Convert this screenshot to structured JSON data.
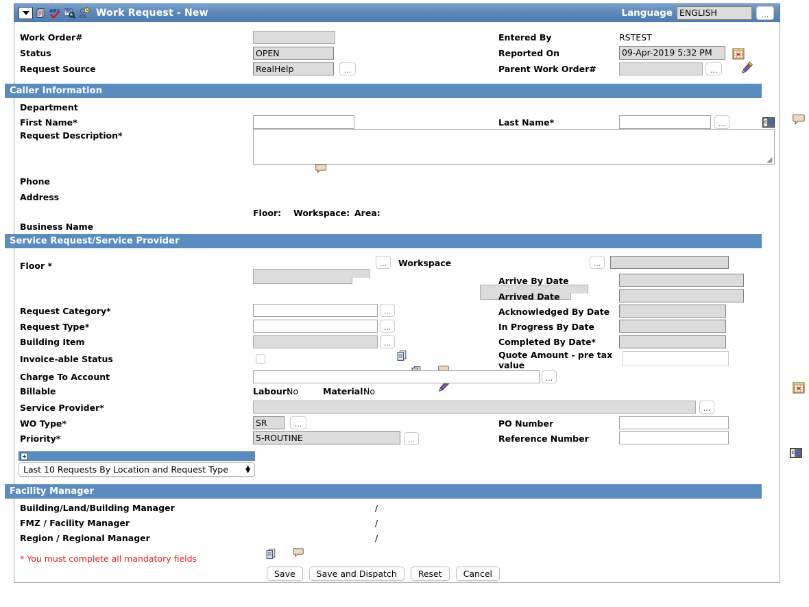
{
  "titlebar": {
    "title": "Work Request - New",
    "language_label": "Language",
    "language_value": "ENGLISH",
    "ellipsis": "...",
    "icons": [
      "dropdown-arrow-icon",
      "copy-records-icon",
      "spellcheck-abc-icon",
      "save-as-icon",
      "user-clock-icon"
    ]
  },
  "top": {
    "work_order_label": "Work Order#",
    "work_order_value": "",
    "status_label": "Status",
    "status_value": "OPEN",
    "request_source_label": "Request Source",
    "request_source_value": "RealHelp",
    "entered_by_label": "Entered By",
    "entered_by_value": "RSTEST",
    "reported_on_label": "Reported On",
    "reported_on_value": "09-Apr-2019 5:32 PM",
    "parent_work_order_label": "Parent Work Order#",
    "parent_work_order_value": "",
    "ellipsis": "..."
  },
  "caller": {
    "section_title": "Caller Information",
    "department_label": "Department",
    "first_name_label": "First Name*",
    "first_name_value": "",
    "last_name_label": "Last Name*",
    "last_name_value": "",
    "request_description_label": "Request Description*",
    "request_description_value": "",
    "phone_label": "Phone",
    "address_label": "Address",
    "floor_label": "Floor:",
    "workspace_label": "Workspace:",
    "area_label": "Area:",
    "business_name_label": "Business Name",
    "ellipsis": "..."
  },
  "service": {
    "section_title": "Service Request/Service Provider",
    "floor_label": "Floor *",
    "floor_value": "",
    "workspace_label": "Workspace",
    "workspace_value": "",
    "workspace_extra_value": "",
    "arrive_by_date_label": "Arrive By Date",
    "arrive_by_date_value": "",
    "arrived_date_label": "Arrived Date",
    "arrived_date_value": "",
    "request_category_label": "Request Category*",
    "request_category_value": "",
    "acknowledged_by_date_label": "Acknowledged By Date",
    "acknowledged_by_date_value": "",
    "request_type_label": "Request Type*",
    "request_type_value": "",
    "in_progress_by_date_label": "In Progress By Date",
    "in_progress_by_date_value": "",
    "building_item_label": "Building Item",
    "building_item_value": "",
    "completed_by_date_label": "Completed By Date*",
    "completed_by_date_value": "",
    "invoiceable_status_label": "Invoice-able Status",
    "invoiceable_status_checked": false,
    "quote_amount_label": "Quote Amount - pre tax value",
    "quote_amount_value": "",
    "charge_to_account_label": "Charge To Account",
    "charge_to_account_value": "",
    "billable_label": "Billable",
    "labour_label": "Labour:",
    "labour_value": "No",
    "material_label": "Material:",
    "material_value": "No",
    "service_provider_label": "Service Provider*",
    "service_provider_value": "",
    "wo_type_label": "WO Type*",
    "wo_type_value": "SR",
    "po_number_label": "PO Number",
    "po_number_value": "",
    "priority_label": "Priority*",
    "priority_value": "5-ROUTINE",
    "reference_number_label": "Reference Number",
    "reference_number_value": "",
    "ellipsis": "..."
  },
  "history": {
    "select_value": "Last 10 Requests By Location and Request Type"
  },
  "facility": {
    "section_title": "Facility Manager",
    "building_land_label": "Building/Land/Building Manager",
    "building_land_value": "/",
    "fmz_label": "FMZ / Facility Manager",
    "fmz_value": "/",
    "region_label": "Region / Regional Manager",
    "region_value": "/"
  },
  "footer": {
    "mandatory_note": "* You must complete all mandatory fields",
    "save_label": "Save",
    "save_dispatch_label": "Save and Dispatch",
    "reset_label": "Reset",
    "cancel_label": "Cancel"
  },
  "colors": {
    "header_blue": "#5b8cc0",
    "title_blue": "#5b86b8",
    "mandatory_red": "#e32219",
    "disabled_gray": "#dcdcdc"
  }
}
